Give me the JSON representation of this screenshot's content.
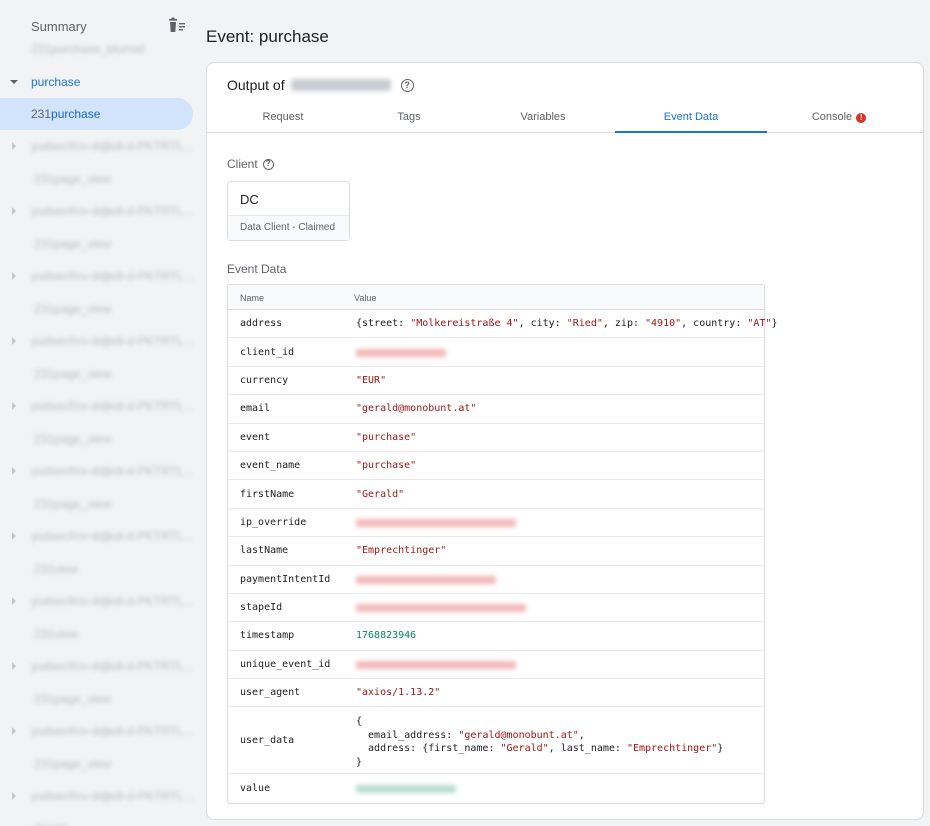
{
  "sidebar": {
    "summary_label": "Summary",
    "active_group": "purchase",
    "selected_item": {
      "number": "231",
      "label": "purchase"
    },
    "items": [
      {
        "label": "231purchase_blurred",
        "type": "child"
      },
      {
        "label": "yudsecf/cv-ddjkdi-d-PKTRTL...",
        "type": "group"
      },
      {
        "label": "231page_view",
        "type": "child"
      },
      {
        "label": "yudsecf/cv-ddjkdi-d-PKTRTL...",
        "type": "group"
      },
      {
        "label": "231page_view",
        "type": "child"
      },
      {
        "label": "yudsecf/cv-ddjkdi-d-PKTRTL...",
        "type": "group"
      },
      {
        "label": "231page_view",
        "type": "child"
      },
      {
        "label": "yudsecf/cv-ddjkdi-d-PKTRTL...",
        "type": "group"
      },
      {
        "label": "231page_view",
        "type": "child"
      },
      {
        "label": "yudsecf/cv-ddjkdi-d-PKTRTL...",
        "type": "group"
      },
      {
        "label": "231page_view",
        "type": "child"
      },
      {
        "label": "yudsecf/cv-ddjkdi-d-PKTRTL...",
        "type": "group"
      },
      {
        "label": "231page_view",
        "type": "child"
      },
      {
        "label": "yudsecf/cv-ddjkdi-d-PKTRTL...",
        "type": "group"
      },
      {
        "label": "231view",
        "type": "child"
      },
      {
        "label": "yudsecf/cv-ddjkdi-d-PKTRTL...",
        "type": "group"
      },
      {
        "label": "231view",
        "type": "child"
      },
      {
        "label": "yudsecf/cv-ddjkdi-d-PKTRTL...",
        "type": "group"
      },
      {
        "label": "231page_view",
        "type": "child"
      },
      {
        "label": "yudsecf/cv-ddjkdi-d-PKTRTL...",
        "type": "group"
      },
      {
        "label": "231page_view",
        "type": "child"
      },
      {
        "label": "yudsecf/cv-ddjkdi-d-PKTRTL...",
        "type": "group"
      },
      {
        "label": "23105",
        "type": "child"
      }
    ]
  },
  "page_title": "Event: purchase",
  "output_label": "Output of",
  "tabs": [
    {
      "label": "Request"
    },
    {
      "label": "Tags"
    },
    {
      "label": "Variables"
    },
    {
      "label": "Event Data",
      "active": true
    },
    {
      "label": "Console",
      "badge": "!"
    }
  ],
  "client": {
    "section_label": "Client",
    "code": "DC",
    "status": "Data Client - Claimed"
  },
  "event_data": {
    "section_label": "Event Data",
    "col_name": "Name",
    "col_value": "Value",
    "rows": [
      {
        "name": "address",
        "value": "{street: \"Molkereistraße 4\", city: \"Ried\", zip: \"4910\", country: \"AT\"}"
      },
      {
        "name": "client_id",
        "value": "",
        "blurred": true
      },
      {
        "name": "currency",
        "value": "\"EUR\""
      },
      {
        "name": "email",
        "value": "\"gerald@monobunt.at\""
      },
      {
        "name": "event",
        "value": "\"purchase\""
      },
      {
        "name": "event_name",
        "value": "\"purchase\""
      },
      {
        "name": "firstName",
        "value": "\"Gerald\""
      },
      {
        "name": "ip_override",
        "value": "",
        "blurred": true
      },
      {
        "name": "lastName",
        "value": "\"Emprechtinger\""
      },
      {
        "name": "paymentIntentId",
        "value": "",
        "blurred": true
      },
      {
        "name": "stapeId",
        "value": "",
        "blurred": true
      },
      {
        "name": "timestamp",
        "value": "1768823946"
      },
      {
        "name": "unique_event_id",
        "value": "",
        "blurred": true
      },
      {
        "name": "user_agent",
        "value": "\"axios/1.13.2\""
      },
      {
        "name": "user_data",
        "value": "{\n  email_address: \"gerald@monobunt.at\",\n  address: {first_name: \"Gerald\", last_name: \"Emprechtinger\"}\n}"
      },
      {
        "name": "value",
        "value": "",
        "blurred": true
      }
    ]
  }
}
